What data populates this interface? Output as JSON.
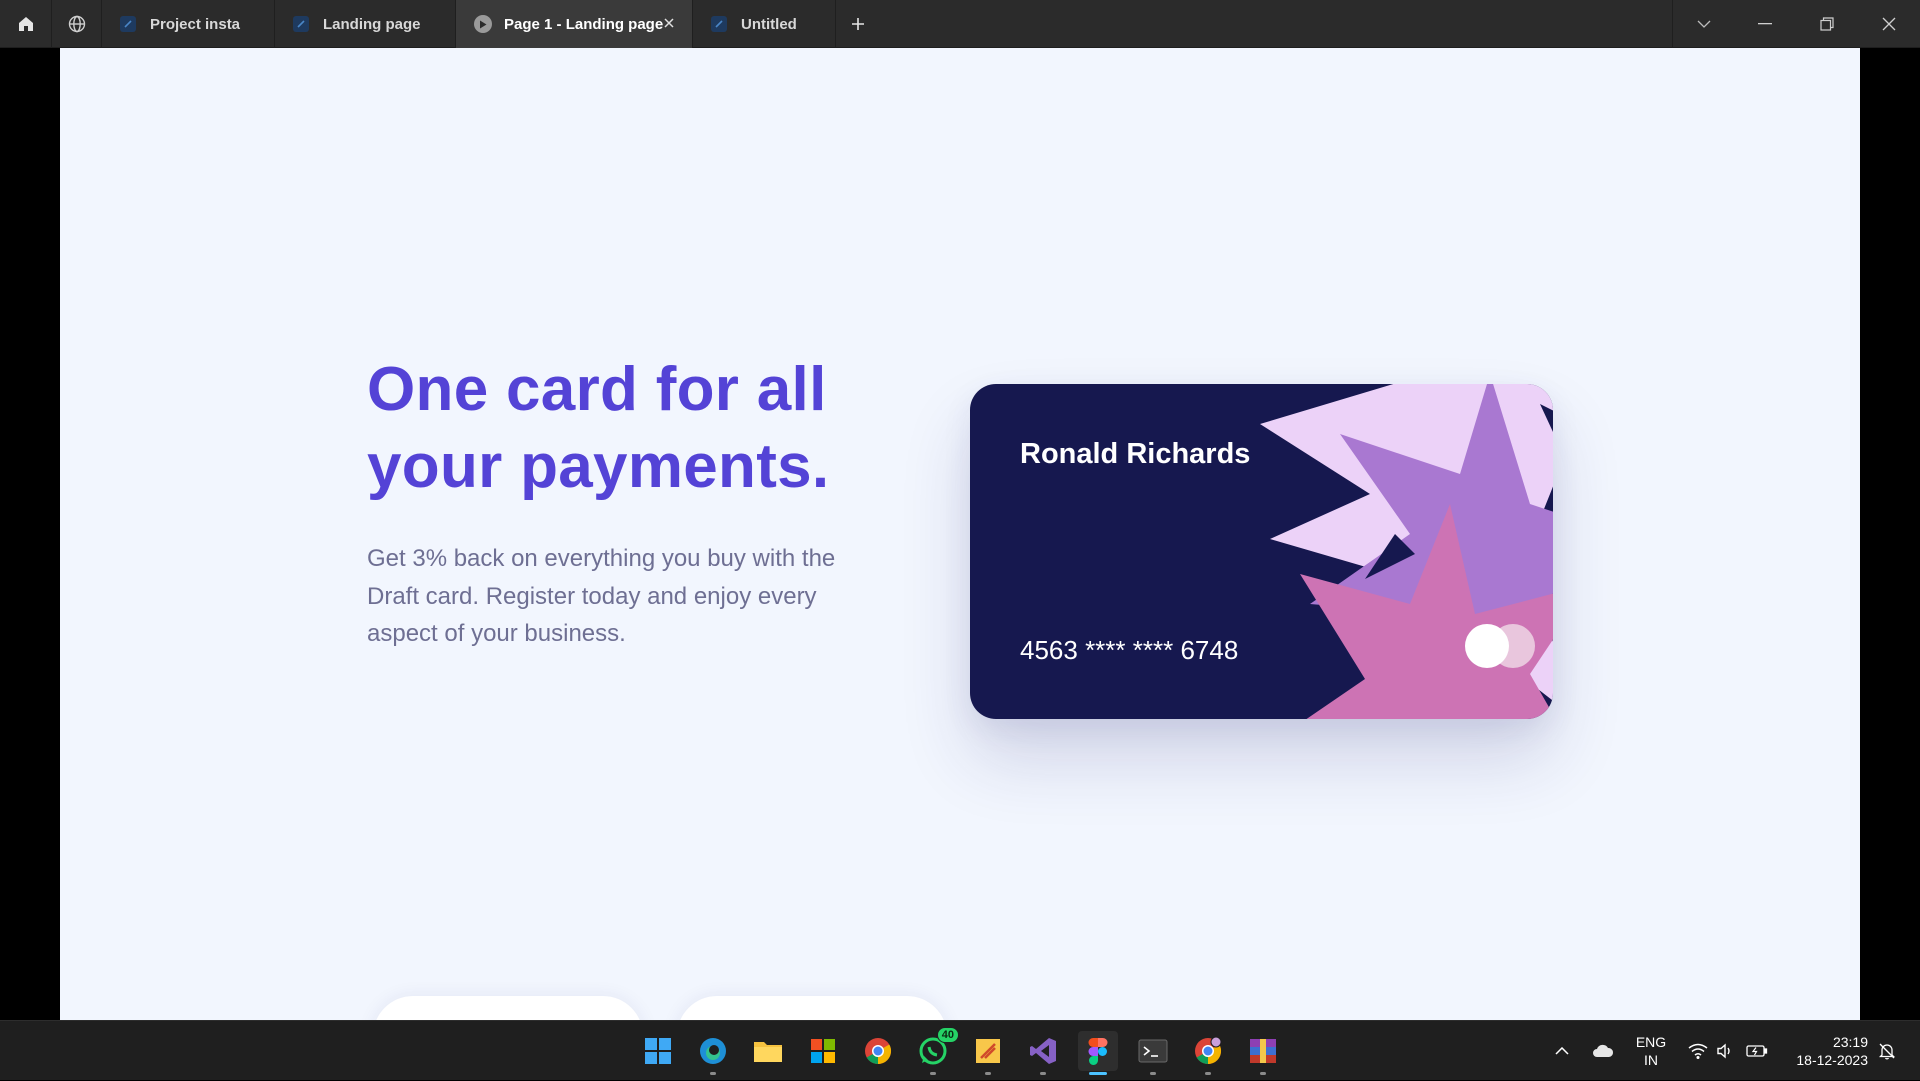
{
  "titlebar": {
    "tabs": [
      {
        "label": "Project insta"
      },
      {
        "label": "Landing page"
      },
      {
        "label": "Page 1 - Landing page"
      },
      {
        "label": "Untitled"
      }
    ]
  },
  "prototype": {
    "headline_line1": "One card for all",
    "headline_line2": "your payments.",
    "description": "Get 3% back on everything you buy with the Draft  card. Register today and enjoy every aspect of your business.",
    "card": {
      "holder_name": "Ronald Richards",
      "number": "4563 **** **** 6748"
    },
    "colors": {
      "headline": "#5443d6",
      "description": "#6e6f93",
      "card_background": "#16184f",
      "star_light": "#ecd2f8",
      "star_mid": "#a978d1",
      "star_pink": "#cd73b4",
      "canvas": "#f2f6fe"
    }
  },
  "taskbar": {
    "apps": [
      {
        "icon": "windows-start-icon"
      },
      {
        "icon": "edge-browser-icon"
      },
      {
        "icon": "file-explorer-icon"
      },
      {
        "icon": "microsoft-store-icon"
      },
      {
        "icon": "chrome-icon"
      },
      {
        "icon": "whatsapp-icon",
        "badge": "40"
      },
      {
        "icon": "sticky-app-icon"
      },
      {
        "icon": "visual-studio-icon"
      },
      {
        "icon": "figma-icon"
      },
      {
        "icon": "terminal-icon"
      },
      {
        "icon": "chrome-profile-icon"
      },
      {
        "icon": "winrar-icon"
      }
    ],
    "language_line1": "ENG",
    "language_line2": "IN",
    "time": "23:19",
    "date": "18-12-2023"
  }
}
